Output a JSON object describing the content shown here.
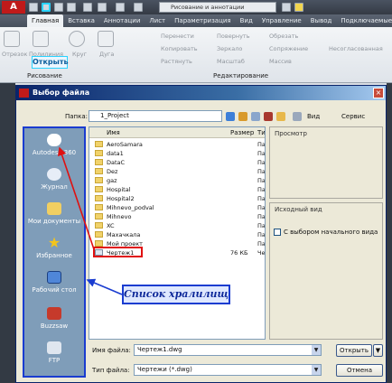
{
  "ribbon": {
    "workspace": "Рисование и аннотации",
    "tabs": [
      "Главная",
      "Вставка",
      "Аннотации",
      "Лист",
      "Параметризация",
      "Вид",
      "Управление",
      "Вывод",
      "Подключаемые мод"
    ],
    "tools_draw": [
      "Отрезок",
      "Полилиния",
      "Круг",
      "Дуга"
    ],
    "tools_edit_col1": [
      "Перенести",
      "Копировать",
      "Растянуть"
    ],
    "tools_edit_col2": [
      "Повернуть",
      "Зеркало",
      "Масштаб"
    ],
    "tools_edit_col3": [
      "Обрезать",
      "Сопряжение",
      "Массив"
    ],
    "tools_right": [
      "Несогласованная"
    ],
    "group_draw": "Рисование",
    "group_edit": "Редактирование",
    "open_callout": "Открыть"
  },
  "dialog": {
    "title": "Выбор файла",
    "folder_label": "Папка:",
    "folder_value": "1_Project",
    "view_label": "Вид",
    "service_label": "Сервис",
    "close_glyph": "×"
  },
  "places": [
    {
      "label": "Autodesk 360",
      "icon": "cloud-icon"
    },
    {
      "label": "Журнал",
      "icon": "history-icon"
    },
    {
      "label": "Мои документы",
      "icon": "documents-icon"
    },
    {
      "label": "Избранное",
      "icon": "star-icon"
    },
    {
      "label": "Рабочий стол",
      "icon": "desktop-icon"
    },
    {
      "label": "Buzzsaw",
      "icon": "buzzsaw-icon"
    },
    {
      "label": "FTP",
      "icon": "ftp-icon"
    }
  ],
  "file_list": {
    "columns": [
      "Имя",
      "Размер",
      "Ти"
    ],
    "rows": [
      {
        "name": "AeroSamara",
        "size": "",
        "type": "Па"
      },
      {
        "name": "data1",
        "size": "",
        "type": "Па"
      },
      {
        "name": "DataC",
        "size": "",
        "type": "Па"
      },
      {
        "name": "Dez",
        "size": "",
        "type": "Па"
      },
      {
        "name": "gaz",
        "size": "",
        "type": "Па"
      },
      {
        "name": "Hospital",
        "size": "",
        "type": "Па"
      },
      {
        "name": "Hospital2",
        "size": "",
        "type": "Па"
      },
      {
        "name": "Mihnevo_podval",
        "size": "",
        "type": "Па"
      },
      {
        "name": "Mihnevo",
        "size": "",
        "type": "Па"
      },
      {
        "name": "XC",
        "size": "",
        "type": "Па"
      },
      {
        "name": "Махачкала",
        "size": "",
        "type": "Па"
      },
      {
        "name": "Мой проект",
        "size": "",
        "type": "Па"
      },
      {
        "name": "Чертеж1",
        "size": "76 КБ",
        "type": "Че"
      }
    ]
  },
  "preview": {
    "title": "Просмотр",
    "initial_view_title": "Исходный вид",
    "initial_view_checkbox": "С выбором начального вида"
  },
  "bottom": {
    "filename_label": "Имя файла:",
    "filename_value": "Чертеж1.dwg",
    "filetype_label": "Тип файла:",
    "filetype_value": "Чертежи (*.dwg)",
    "open_button": "Открыть",
    "cancel_button": "Отмена"
  },
  "annotation": {
    "storage_list": "Список хралилищ"
  },
  "colors": {
    "cyan_callout": "#29d3ff",
    "red_highlight": "#e01010",
    "blue_annotation": "#1a3cd0"
  }
}
